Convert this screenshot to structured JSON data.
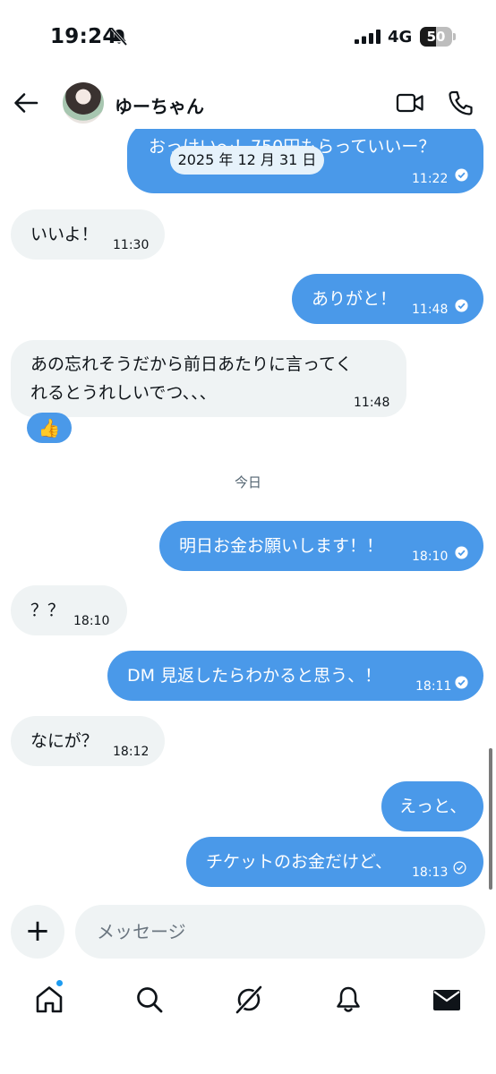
{
  "status_bar": {
    "time": "19:24",
    "network": "4G",
    "battery": 50,
    "battery_label": "50"
  },
  "header": {
    "contact_name": "ゆーちゃん",
    "icons": [
      "back-arrow-icon",
      "video-call-icon",
      "phone-call-icon"
    ]
  },
  "conversation": {
    "date_separator": "2025 年 12 月 31 日",
    "today_separator": "今日",
    "messages": [
      {
        "dir": "out",
        "text": "おっけい〜！750円もらっていいー？",
        "time": "11:22",
        "read": true
      },
      {
        "dir": "in",
        "text": "いいよ！",
        "time": "11:30"
      },
      {
        "dir": "out",
        "text": "ありがと！",
        "time": "11:48",
        "read": true
      },
      {
        "dir": "in",
        "line1": "あの忘れそうだから前日あたりに言ってく",
        "line2": "れるとうれしいでつ、、、",
        "time": "11:48",
        "reaction": "👍"
      },
      {
        "dir": "out",
        "text": "明日お金お願いします！！",
        "time": "18:10",
        "read": true
      },
      {
        "dir": "in",
        "text": "？？",
        "time": "18:10"
      },
      {
        "dir": "out",
        "text": "DM 見返したらわかると思う、！",
        "time": "18:11",
        "read": true
      },
      {
        "dir": "in",
        "text": "なにが？",
        "time": "18:12"
      },
      {
        "dir": "out",
        "text": "えっと、"
      },
      {
        "dir": "out",
        "text": "チケットのお金だけど、",
        "time": "18:13",
        "read": false
      }
    ]
  },
  "composer": {
    "placeholder": "メッセージ",
    "add_label": "+"
  },
  "tab_bar": {
    "items": [
      "home-icon",
      "search-icon",
      "grok-icon",
      "notifications-icon",
      "messages-icon"
    ],
    "colors": {
      "accent": "#1d9bf0",
      "bubble_out": "#4a99e9",
      "bubble_in": "#eff3f4"
    }
  }
}
